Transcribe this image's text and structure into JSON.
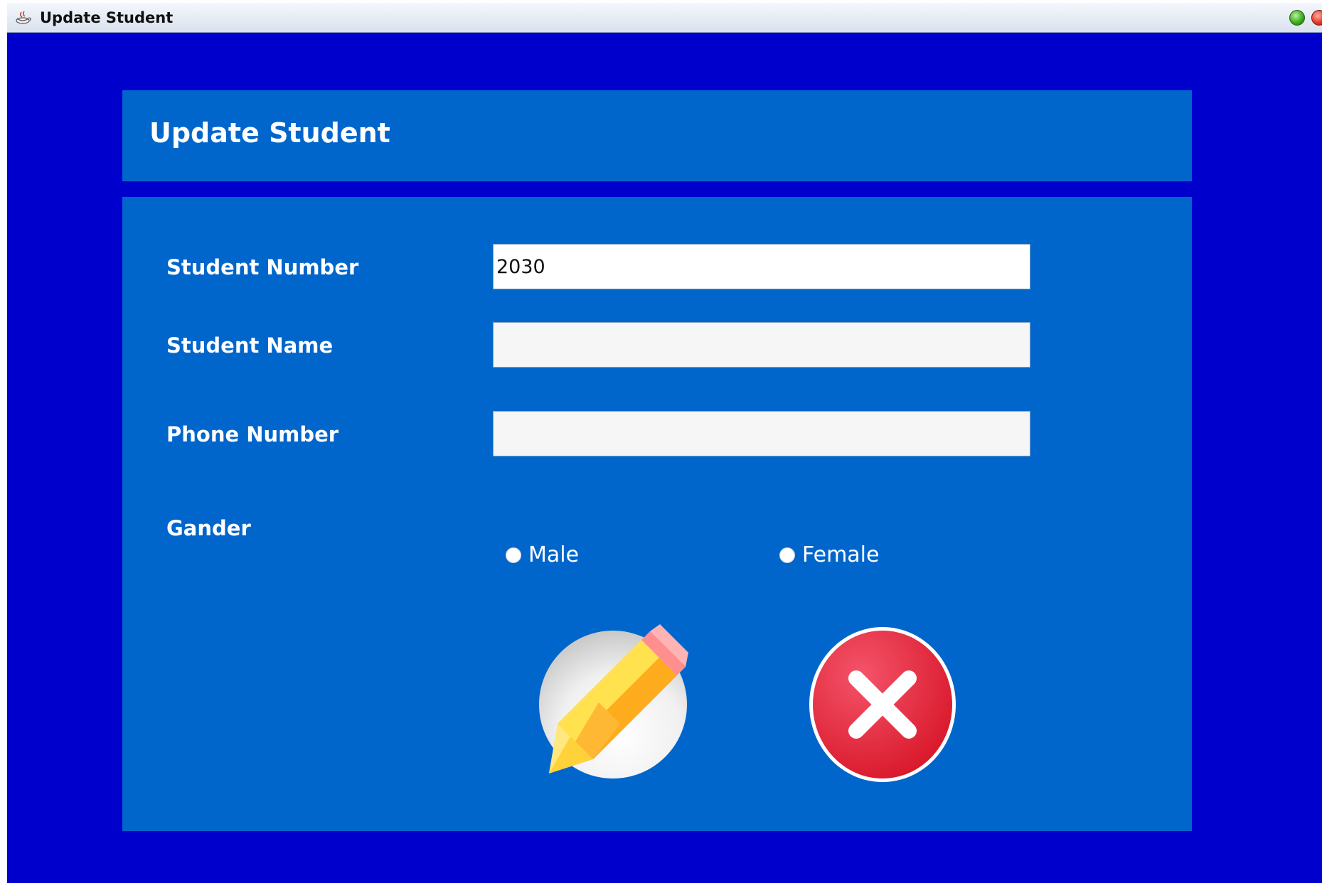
{
  "window": {
    "title": "Update Student"
  },
  "header": {
    "title": "Update Student"
  },
  "form": {
    "student_number": {
      "label": "Student Number",
      "value": "2030"
    },
    "student_name": {
      "label": "Student Name",
      "value": ""
    },
    "phone_number": {
      "label": "Phone Number",
      "value": ""
    },
    "gender": {
      "label": "Gander",
      "options": [
        "Male",
        "Female"
      ]
    }
  },
  "actions": {
    "update_icon": "pencil-icon",
    "cancel_icon": "close-icon"
  },
  "colors": {
    "window_bg": "#0000cd",
    "panel_bg": "#0066cc",
    "cancel_red": "#e02436",
    "pencil_yellow": "#ffc928"
  }
}
